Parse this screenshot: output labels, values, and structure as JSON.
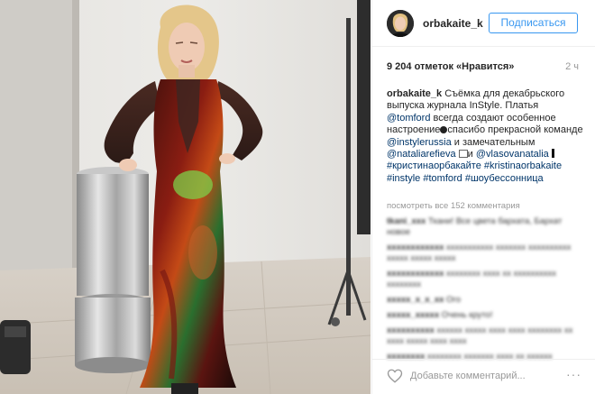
{
  "post": {
    "username": "orbakaite_k",
    "follow_label": "Подписаться",
    "likes": "9 204 отметок «Нравится»",
    "time_ago": "2 ч",
    "caption_parts": {
      "user": "orbakaite_k",
      "p1": " Съёмка для декабрьского выпуска журнала InStyle. Платья ",
      "m1": "@tomford",
      "p2": " всегда создают особенное настроение",
      "p3": "спасибо прекрасной команде ",
      "m2": "@instylerussia",
      "p4": " и замечательным ",
      "m3": "@nataliarefieva",
      "p5": "и ",
      "m4": "@vlasovanatalia",
      "t1": "#кристинаорбакайте",
      "t2": "#kristinaorbakaite",
      "t3": "#instyle",
      "t4": "#tomford",
      "t5": "#шоубессонница"
    },
    "load_more": "посмотреть все 152 комментария",
    "comments": [
      {
        "user": "tkani_xxx",
        "text": "Ткани! Все цвета бархата, Бархат новое"
      },
      {
        "user": "xxxxxxxxxxxx",
        "text": "xxxxxxxxxxx xxxxxxx xxxxxxxxxx xxxxx xxxxx xxxxx"
      },
      {
        "user": "xxxxxxxxxxxx",
        "text": "xxxxxxxx xxxx xx xxxxxxxxxx xxxxxxxx"
      },
      {
        "user": "xxxxx_x_x_xx",
        "text": "Ого"
      },
      {
        "user": "xxxxx_xxxxx",
        "text": "Очень круто!"
      },
      {
        "user": "xxxxxxxxxx",
        "text": "xxxxxx xxxxx xxxx xxxx xxxxxxxx xx xxxx xxxxx xxxx xxxx"
      },
      {
        "user": "xxxxxxxx",
        "text": "xxxxxxxx xxxxxxx xxxx xx xxxxxx"
      }
    ],
    "add_comment_placeholder": "Добавьте комментарий...",
    "more_icon": "···"
  }
}
